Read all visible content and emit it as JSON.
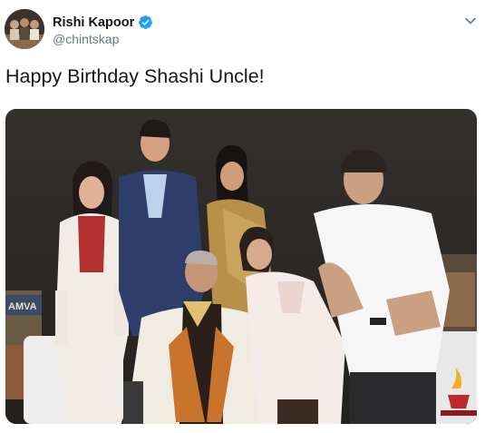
{
  "tweet": {
    "author": {
      "display_name": "Rishi Kapoor",
      "handle": "@chintskap",
      "verified": true,
      "avatar_icon": "profile-photo"
    },
    "menu_icon": "chevron-down-icon",
    "text": "Happy Birthday Shashi Uncle!",
    "media": {
      "type": "photo",
      "banner_text": "AMVA"
    }
  },
  "colors": {
    "verified_blue": "#1da1f2",
    "text_primary": "#14171a",
    "text_secondary": "#657786"
  }
}
